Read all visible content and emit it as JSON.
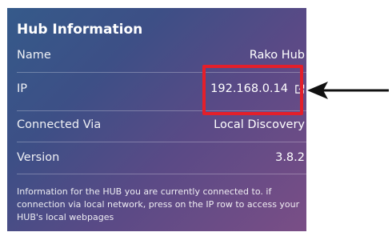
{
  "hub_info": {
    "title": "Hub Information",
    "rows": [
      {
        "label": "Name",
        "value": "Rako Hub"
      },
      {
        "label": "IP",
        "value": "192.168.0.14"
      },
      {
        "label": "Connected Via",
        "value": "Local Discovery"
      },
      {
        "label": "Version",
        "value": "3.8.2"
      }
    ],
    "footer": "Information for the HUB you are currently connected to. if connection via local network, press on the IP row to access your HUB's local webpages"
  },
  "icons": {
    "ip_link": "external-link-icon"
  },
  "colors": {
    "highlight": "#e41f2a",
    "arrow": "#111111"
  }
}
